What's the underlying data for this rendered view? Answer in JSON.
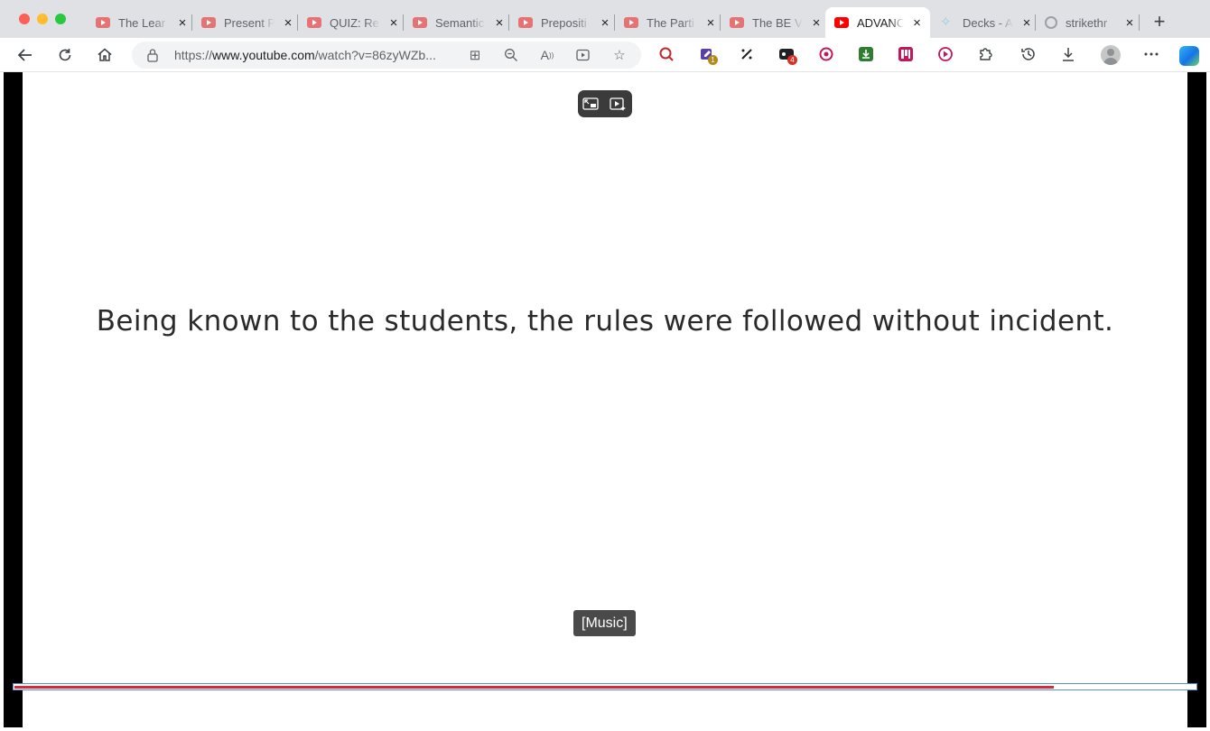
{
  "browser": {
    "tabs": [
      {
        "title": "The Lear",
        "icon": "youtube-icon",
        "active": false
      },
      {
        "title": "Present P",
        "icon": "youtube-icon",
        "active": false
      },
      {
        "title": "QUIZ: Re",
        "icon": "youtube-icon",
        "active": false
      },
      {
        "title": "Semantic",
        "icon": "youtube-icon",
        "active": false
      },
      {
        "title": "Prepositi",
        "icon": "youtube-icon",
        "active": false
      },
      {
        "title": "The Parti",
        "icon": "youtube-icon",
        "active": false
      },
      {
        "title": "The BE V",
        "icon": "youtube-icon",
        "active": false
      },
      {
        "title": "ADVANC",
        "icon": "youtube-icon",
        "active": true
      },
      {
        "title": "Decks - A",
        "icon": "star-icon",
        "active": false
      },
      {
        "title": "strikethr",
        "icon": "google-icon",
        "active": false
      }
    ],
    "tab_close_glyph": "×",
    "new_tab_glyph": "+",
    "url_prefix": "https://",
    "url_domain": "www.youtube.com",
    "url_path": "/watch?v=86zyWZb...",
    "extension_badges": {
      "ext2": "1",
      "ext4": "4"
    },
    "accent_color": "#ff0000"
  },
  "video": {
    "slide_text": "Being known to the students, the rules were followed without incident.",
    "caption": "[Music]",
    "progress_fraction": 0.88,
    "progress_color": "#d8283a"
  }
}
